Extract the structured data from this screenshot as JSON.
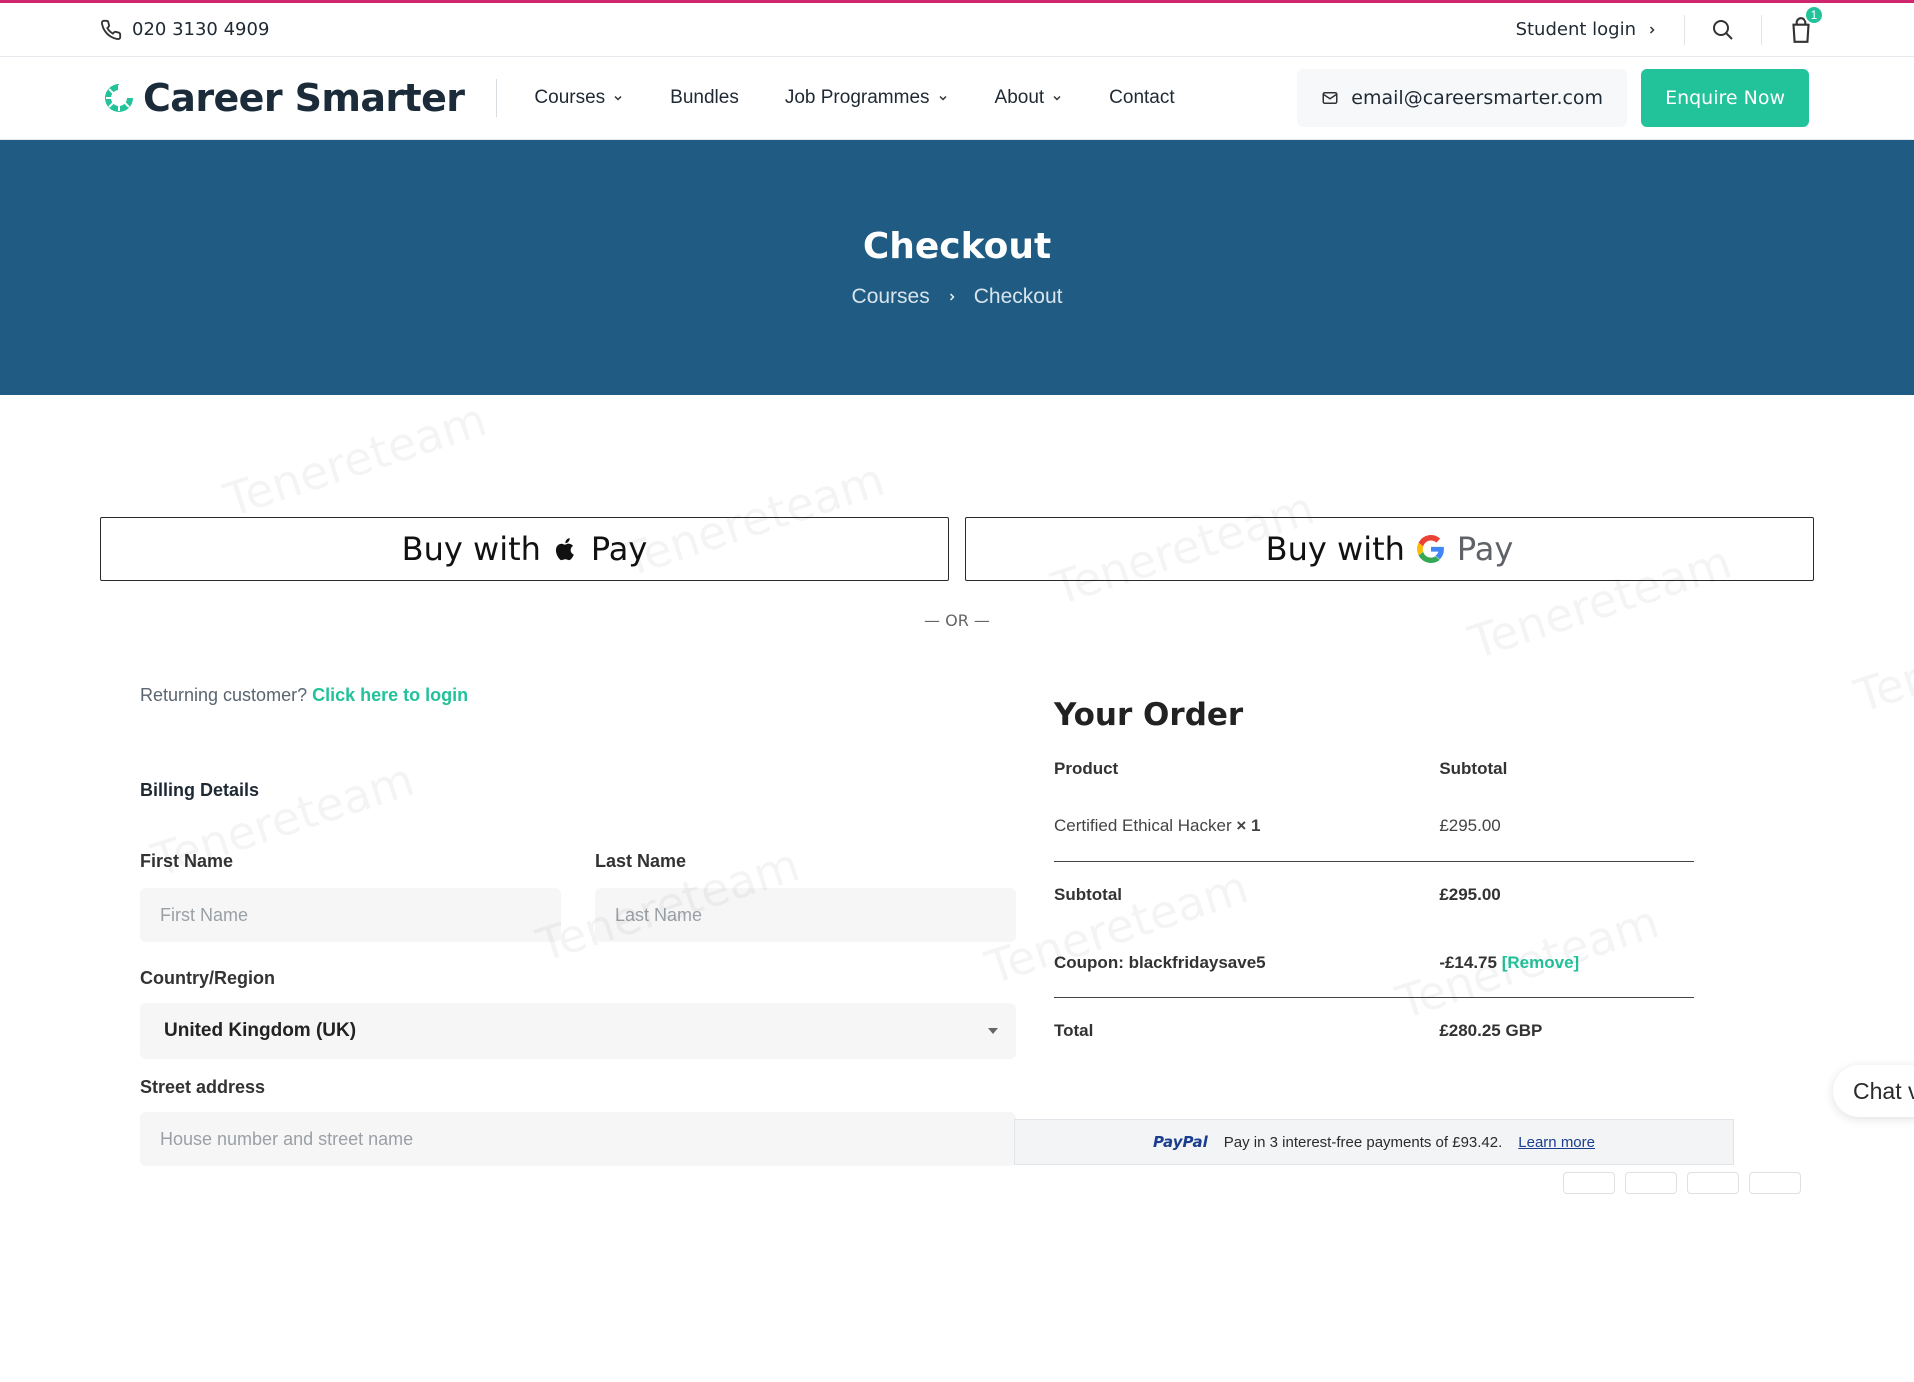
{
  "topbar": {
    "phone": "020 3130 4909",
    "student_login": "Student login",
    "cart_count": "1"
  },
  "header": {
    "brand": "Career Smarter",
    "nav": [
      {
        "label": "Courses",
        "has_dropdown": true
      },
      {
        "label": "Bundles",
        "has_dropdown": false
      },
      {
        "label": "Job Programmes",
        "has_dropdown": true
      },
      {
        "label": "About",
        "has_dropdown": true
      },
      {
        "label": "Contact",
        "has_dropdown": false
      }
    ],
    "email": "email@careersmarter.com",
    "enquire_label": "Enquire Now"
  },
  "hero": {
    "title": "Checkout",
    "breadcrumb": [
      "Courses",
      "Checkout"
    ]
  },
  "payments": {
    "apple_pay_text": "Buy with",
    "apple_pay_suffix": "Pay",
    "google_pay_text": "Buy with",
    "google_pay_suffix": "Pay",
    "or_text": "— OR —"
  },
  "checkout": {
    "returning_text": "Returning customer?",
    "login_link": "Click here to login",
    "billing_title": "Billing Details",
    "first_name_label": "First Name",
    "first_name_placeholder": "First Name",
    "last_name_label": "Last Name",
    "last_name_placeholder": "Last Name",
    "country_label": "Country/Region",
    "country_value": "United Kingdom (UK)",
    "street_label": "Street address",
    "street_placeholder": "House number and street name"
  },
  "order": {
    "title": "Your Order",
    "col_product": "Product",
    "col_subtotal": "Subtotal",
    "item_name": "Certified Ethical Hacker",
    "item_qty": "× 1",
    "item_price": "£295.00",
    "subtotal_label": "Subtotal",
    "subtotal_value": "£295.00",
    "coupon_label": "Coupon: blackfridaysave5",
    "coupon_value": "-£14.75",
    "coupon_remove": "[Remove]",
    "total_label": "Total",
    "total_value": "£280.25 GBP",
    "paypal_brand": "PayPal",
    "paypal_message": "Pay in 3 interest-free payments of £93.42.",
    "paypal_learn_more": "Learn more"
  },
  "chat": {
    "label": "Chat v"
  },
  "watermark": "Tenereteam",
  "colors": {
    "brand": "#22c29a",
    "hero": "#1f5b82",
    "topline": "#d0266d"
  }
}
